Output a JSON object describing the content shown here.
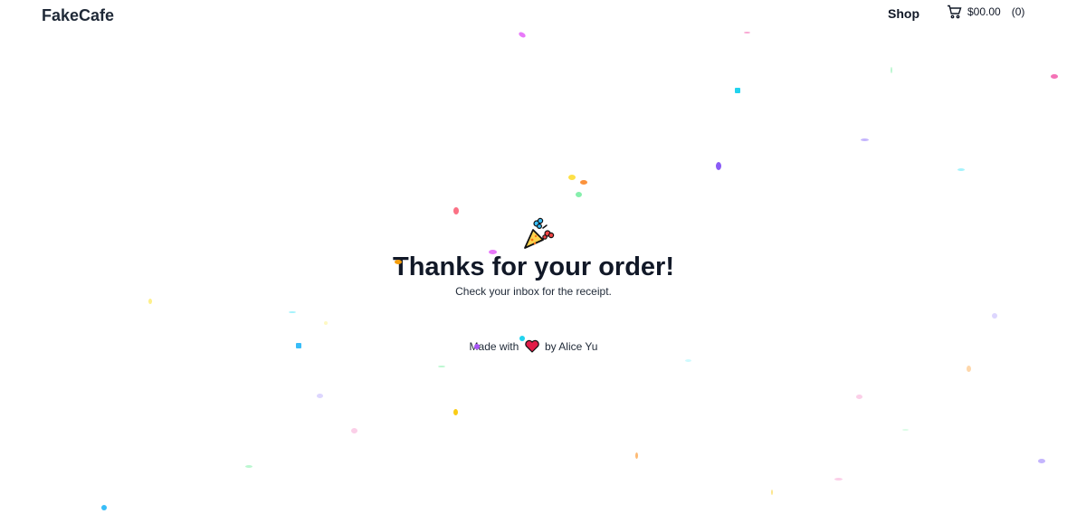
{
  "header": {
    "brand": "FakeCafe",
    "nav_shop": "Shop",
    "cart_total": "$00.00",
    "cart_count": "(0)"
  },
  "main": {
    "icon": "party-popper-icon",
    "title": "Thanks for your order!",
    "subtitle": "Check your inbox for the receipt."
  },
  "footer": {
    "made_with": "Made with",
    "heart_icon": "heart-icon",
    "by": "by Alice Yu"
  },
  "colors": {
    "heart": "#e11d48",
    "confetti": [
      "#f472b6",
      "#22d3ee",
      "#a78bfa",
      "#fde047",
      "#f97316",
      "#4ade80",
      "#fb7185",
      "#8b5cf6"
    ]
  }
}
